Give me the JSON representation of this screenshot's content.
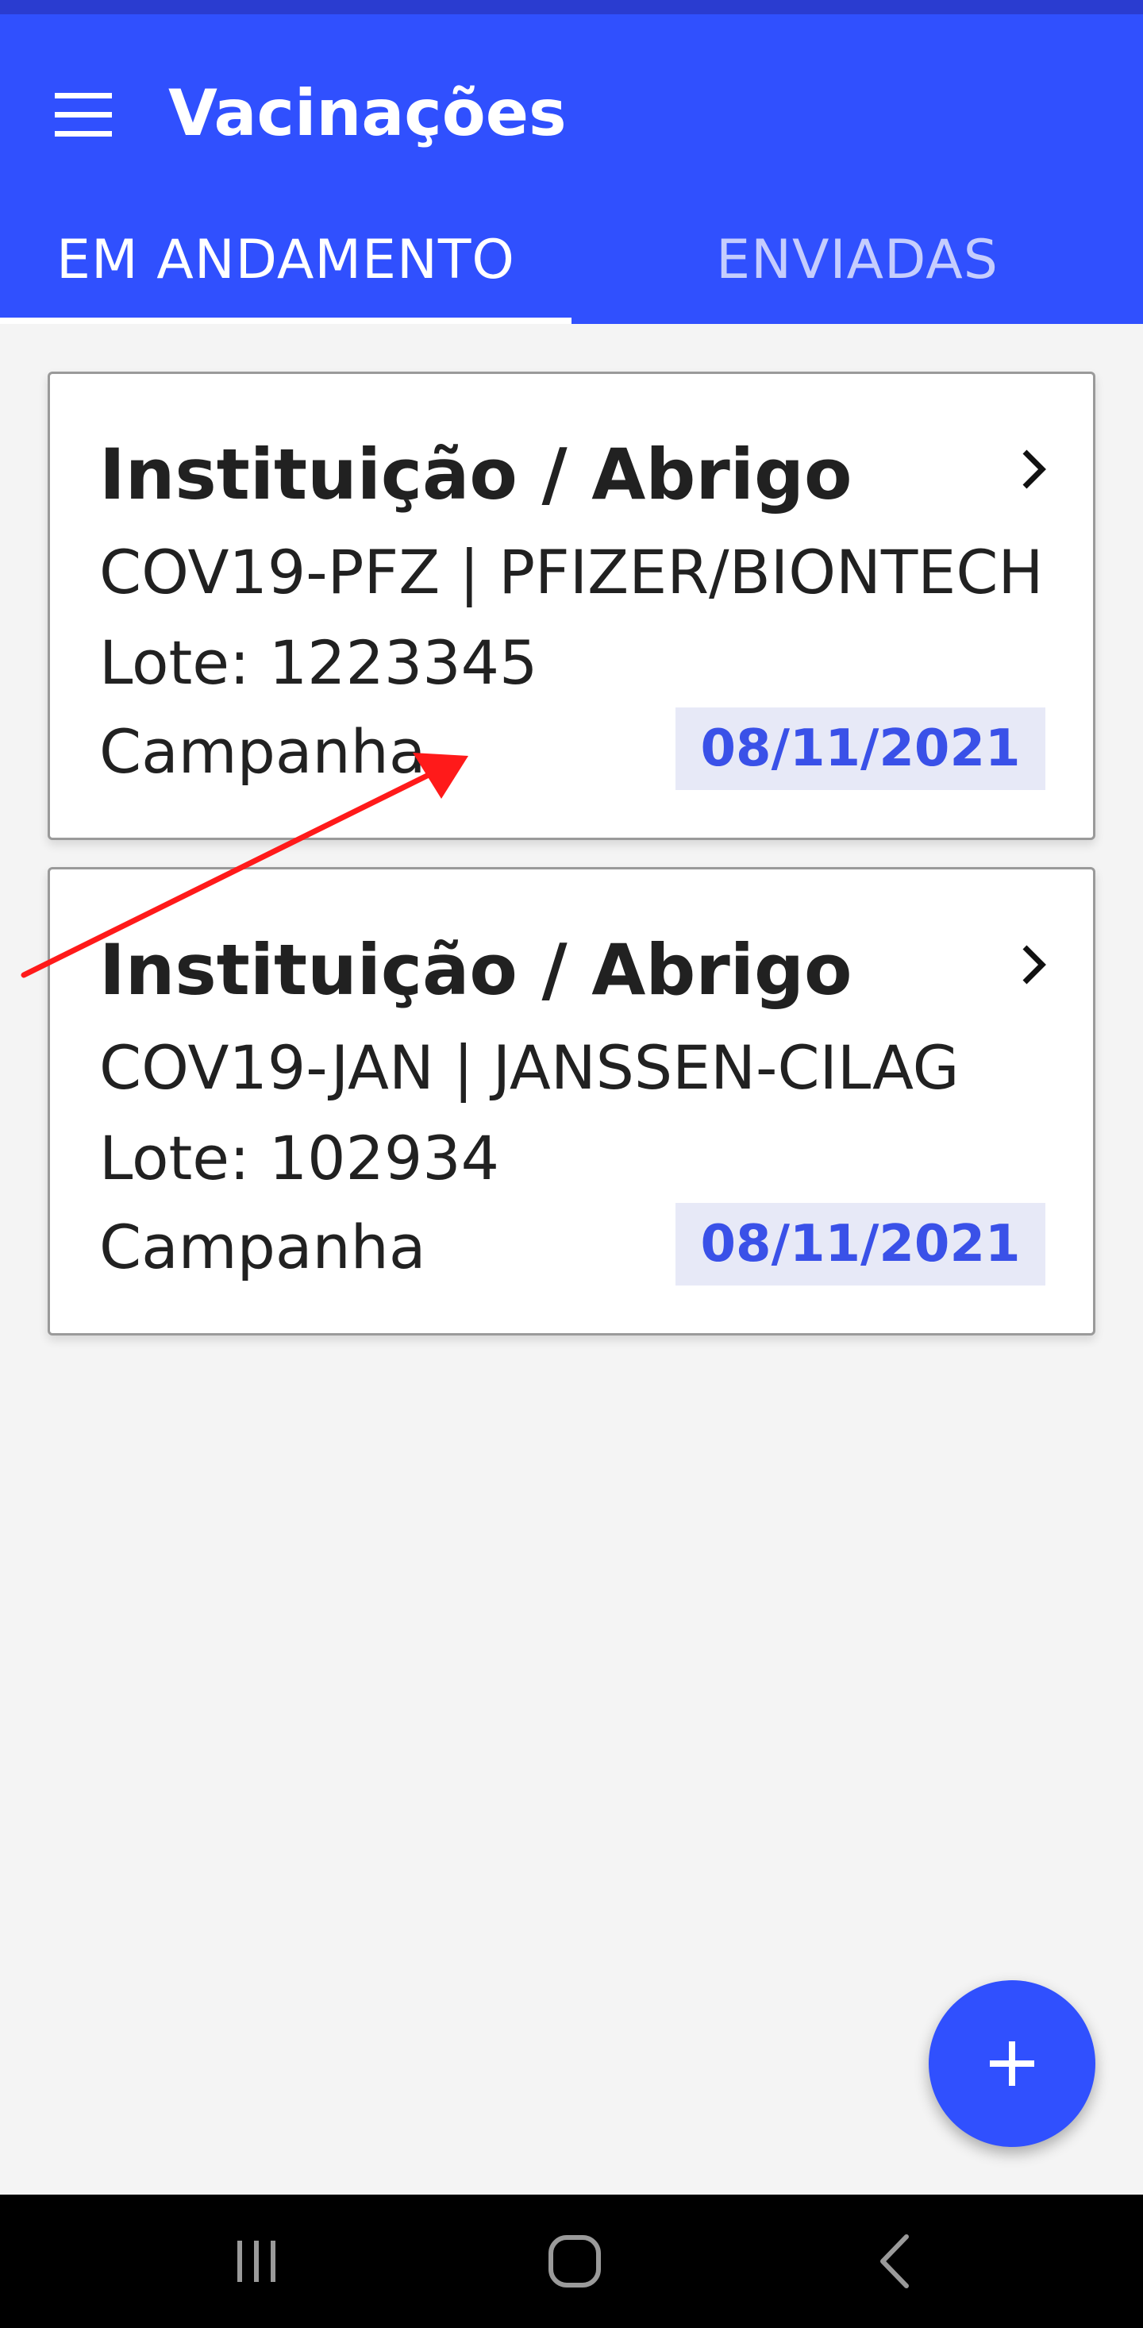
{
  "app_bar": {
    "title": "Vacinações",
    "color": "#3050fe",
    "menu_icon": "menu-icon"
  },
  "tabs": [
    {
      "label": "EM ANDAMENTO",
      "active": true
    },
    {
      "label": "ENVIADAS",
      "active": false
    }
  ],
  "cards": [
    {
      "title": "Instituição / Abrigo",
      "vaccine": "COV19-PFZ | PFIZER/BIONTECH",
      "lote": "Lote: 1223345",
      "campaign": "Campanha",
      "date": "08/11/2021"
    },
    {
      "title": "Instituição / Abrigo",
      "vaccine": "COV19-JAN | JANSSEN-CILAG",
      "lote": "Lote: 102934",
      "campaign": "Campanha",
      "date": "08/11/2021"
    }
  ],
  "fab": {
    "icon": "plus-icon",
    "color": "#3050fe"
  },
  "annotation": {
    "icon": "red-arrow",
    "color": "#ff1a1a"
  },
  "nav_bar": {
    "recents_icon": "recents-icon",
    "home_icon": "home-icon",
    "back_icon": "back-icon"
  }
}
